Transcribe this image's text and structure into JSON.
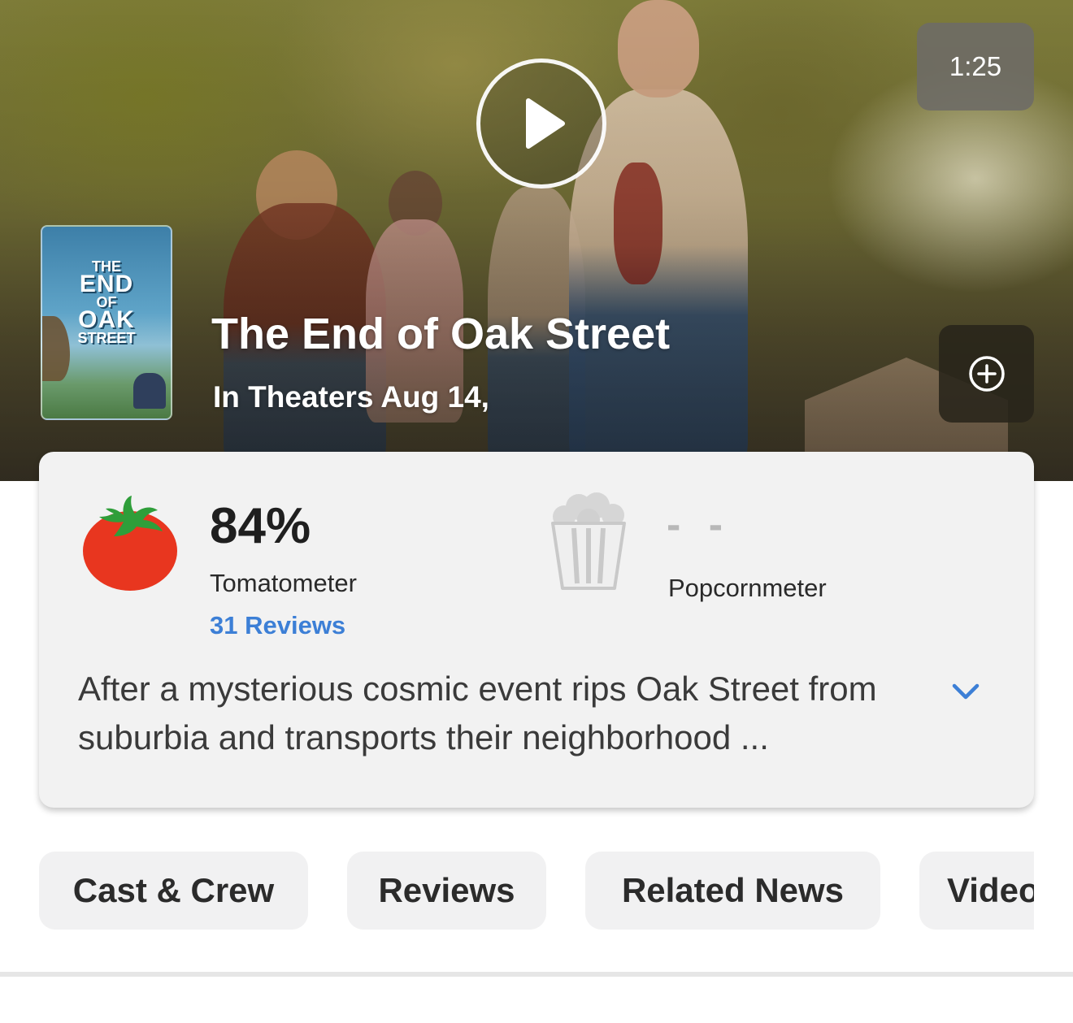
{
  "hero": {
    "duration": "1:25",
    "poster": {
      "title_top": "THE",
      "title_main": "END",
      "title_of": "OF",
      "title_oak": "OAK",
      "title_street": "STREET"
    },
    "title": "The End of Oak Street",
    "release": "In Theaters Aug 14,"
  },
  "icons": {
    "play": "play-icon",
    "add": "plus-circle-icon",
    "tomato": "tomato-icon",
    "popcorn": "popcorn-bucket-icon",
    "expand": "chevron-down-icon"
  },
  "scores": {
    "tomatometer": {
      "value": "84%",
      "label": "Tomatometer",
      "reviews": "31 Reviews"
    },
    "popcornmeter": {
      "value": "- -",
      "label": "Popcornmeter"
    }
  },
  "synopsis": "After a mysterious cosmic event rips Oak Street from suburbia and transports their neighborhood ...",
  "tabs": [
    {
      "label": "Cast & Crew"
    },
    {
      "label": "Reviews"
    },
    {
      "label": "Related News"
    },
    {
      "label": "Videos"
    }
  ],
  "colors": {
    "link": "#3c7fd6",
    "tomato": "#e8361f",
    "tomato_leaf": "#2f9e3a",
    "card_bg": "#f2f2f2",
    "tab_bg": "#f1f1f2"
  }
}
